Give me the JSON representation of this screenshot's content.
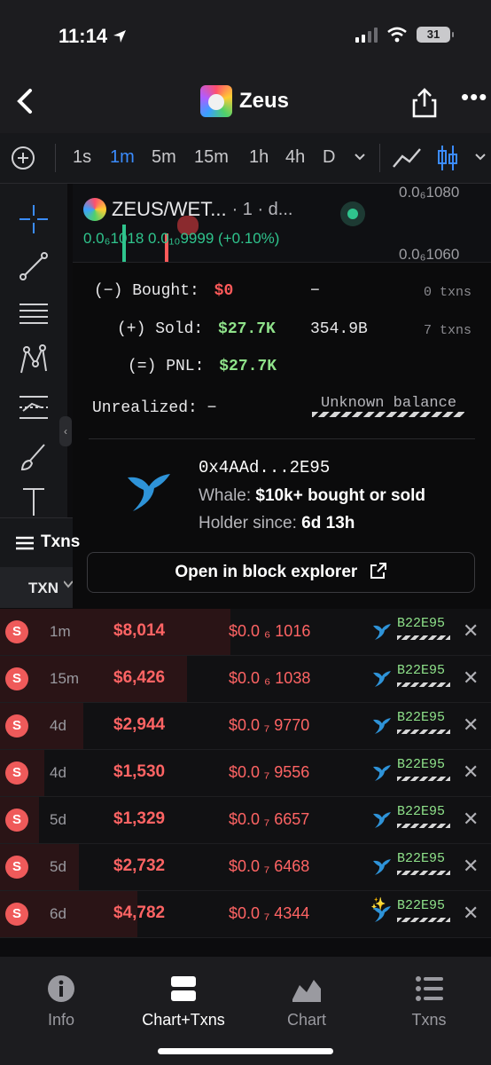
{
  "status": {
    "time": "11:14",
    "battery": "31"
  },
  "header": {
    "title": "Zeus"
  },
  "timeframes": [
    {
      "label": "1s",
      "active": false
    },
    {
      "label": "1m",
      "active": true
    },
    {
      "label": "5m",
      "active": false
    },
    {
      "label": "15m",
      "active": false
    },
    {
      "label": "1h",
      "active": false
    },
    {
      "label": "4h",
      "active": false
    },
    {
      "label": "D",
      "active": false
    }
  ],
  "chart": {
    "pair": "ZEUS/WET...",
    "meta": "· 1 · d...",
    "price_line": "0.0₆1018  0.0₁₀9999 (+0.10%)",
    "axis_top": "0.0₆1080",
    "axis_mid": "0.0₆1060"
  },
  "popup": {
    "bought_label": "(−) Bought:",
    "bought_value": "$0",
    "bought_qty": "−",
    "bought_txns": "0 txns",
    "sold_label": "(+) Sold:",
    "sold_value": "$27.7K",
    "sold_qty": "354.9B",
    "sold_txns": "7 txns",
    "pnl_label": "(=) PNL:",
    "pnl_value": "$27.7K",
    "unrealized_label": "Unrealized: −",
    "unknown_balance": "Unknown balance",
    "address": "0x4AAd...2E95",
    "whale_label": "Whale:",
    "whale_value": "$10k+ bought or sold",
    "holder_label": "Holder since:",
    "holder_value": "6d 13h",
    "explorer_button": "Open in block explorer"
  },
  "txns_tab": "Txns",
  "col_txn": "TXN",
  "transactions": [
    {
      "type": "S",
      "age": "1m",
      "amount": "$8,014",
      "price": "$0.0 ₆ 1016",
      "maker": "B22E95",
      "bg_pct": 0.47,
      "spark": false
    },
    {
      "type": "S",
      "age": "15m",
      "amount": "$6,426",
      "price": "$0.0 ₆ 1038",
      "maker": "B22E95",
      "bg_pct": 0.38,
      "spark": false
    },
    {
      "type": "S",
      "age": "4d",
      "amount": "$2,944",
      "price": "$0.0 ₇ 9770",
      "maker": "B22E95",
      "bg_pct": 0.17,
      "spark": false
    },
    {
      "type": "S",
      "age": "4d",
      "amount": "$1,530",
      "price": "$0.0 ₇ 9556",
      "maker": "B22E95",
      "bg_pct": 0.09,
      "spark": false
    },
    {
      "type": "S",
      "age": "5d",
      "amount": "$1,329",
      "price": "$0.0 ₇ 6657",
      "maker": "B22E95",
      "bg_pct": 0.08,
      "spark": false
    },
    {
      "type": "S",
      "age": "5d",
      "amount": "$2,732",
      "price": "$0.0 ₇ 6468",
      "maker": "B22E95",
      "bg_pct": 0.16,
      "spark": false
    },
    {
      "type": "S",
      "age": "6d",
      "amount": "$4,782",
      "price": "$0.0 ₇ 4344",
      "maker": "B22E95",
      "bg_pct": 0.28,
      "spark": true
    }
  ],
  "tabs": [
    {
      "label": "Info",
      "icon": "info-icon",
      "active": false
    },
    {
      "label": "Chart+Txns",
      "icon": "split-view-icon",
      "active": true
    },
    {
      "label": "Chart",
      "icon": "area-chart-icon",
      "active": false
    },
    {
      "label": "Txns",
      "icon": "list-icon",
      "active": false
    }
  ],
  "colors": {
    "accent": "#3b8cff",
    "sell": "#ff6464",
    "profit": "#8fe28a",
    "buy_indicator": "#2fc48d"
  }
}
